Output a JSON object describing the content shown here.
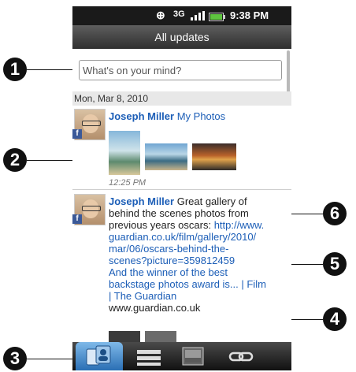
{
  "status_bar": {
    "network": "3G",
    "time": "9:38 PM"
  },
  "title": "All updates",
  "composer": {
    "placeholder": "What's on your mind?"
  },
  "date_header": "Mon, Mar 8, 2010",
  "posts": [
    {
      "author": "Joseph Miller",
      "action_link": "My Photos",
      "timestamp": "12:25 PM",
      "network_icon": "f"
    },
    {
      "author": "Joseph Miller",
      "text_lines": [
        "Great gallery of",
        "behind the scenes photos from",
        "previous years oscars:"
      ],
      "link_lines": [
        "http://www.",
        "guardian.co.uk/film/gallery/2010/",
        "mar/06/oscars-behind-the-",
        "scenes?picture=359812459",
        "And the winner of the best",
        "backstage photos award is... | Film",
        "| The Guardian"
      ],
      "domain": "www.guardian.co.uk",
      "network_icon": "f"
    }
  ],
  "callouts": [
    "1",
    "2",
    "3",
    "4",
    "5",
    "6"
  ],
  "colors": {
    "status_bar": "#1a1a1a",
    "title_bar": "#3f3f3f",
    "link": "#1c5eb7",
    "tab_active": "#2a6fb4"
  },
  "tabs": [
    "updates-tab",
    "status-tab",
    "photos-tab",
    "links-tab"
  ]
}
